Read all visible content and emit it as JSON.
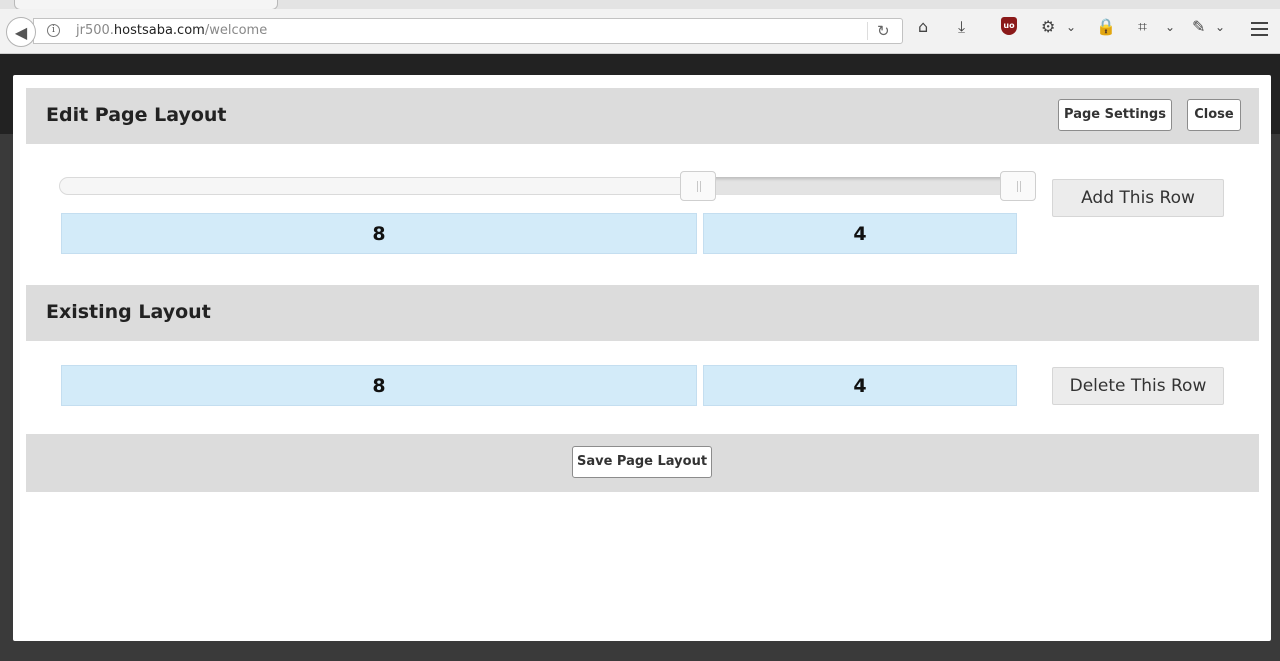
{
  "browser": {
    "url_prefix": "jr500.",
    "url_host": "hostsaba.com",
    "url_path": "/welcome"
  },
  "editor": {
    "title": "Edit Page Layout",
    "page_settings_label": "Page Settings",
    "close_label": "Close",
    "slider_values": [
      8,
      12
    ],
    "add_row_label": "Add This Row",
    "new_row_columns": [
      "8",
      "4"
    ]
  },
  "existing": {
    "title": "Existing Layout",
    "rows": [
      {
        "columns": [
          "8",
          "4"
        ],
        "delete_label": "Delete This Row"
      }
    ]
  },
  "footer": {
    "save_label": "Save Page Layout"
  },
  "colors": {
    "column_fill": "#d3ebf9",
    "bar_gray": "#dcdcdc",
    "ublock_red": "#8b1a1a"
  }
}
